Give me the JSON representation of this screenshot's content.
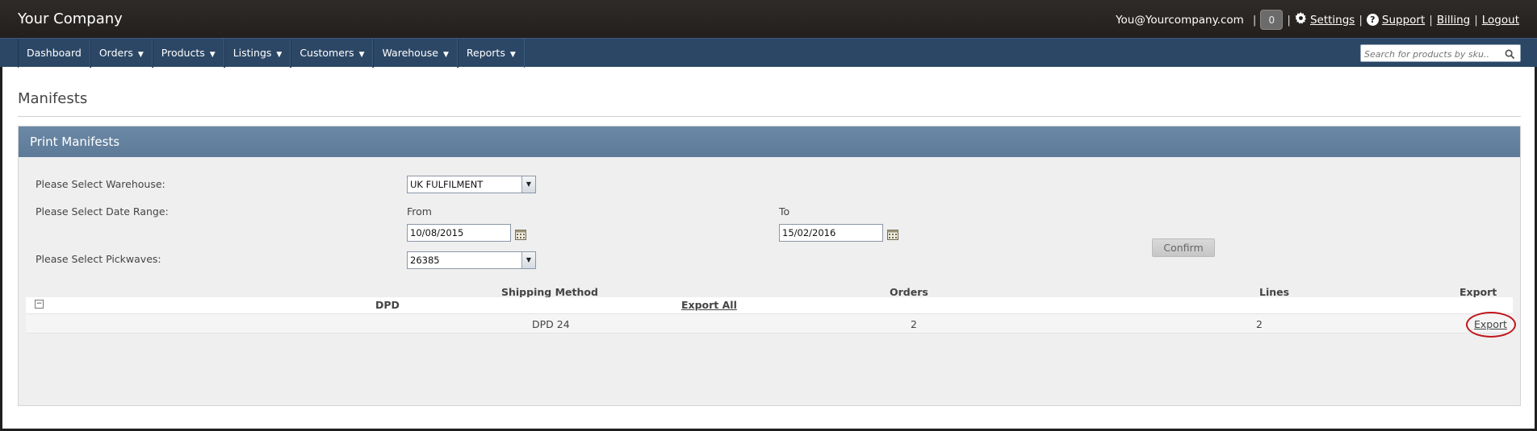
{
  "app": {
    "brand": "Your Company",
    "user_email": "You@Yourcompany.com",
    "notification_count": "0",
    "links": {
      "settings": "Settings",
      "support": "Support",
      "billing": "Billing",
      "logout": "Logout"
    },
    "separator": "|"
  },
  "nav": {
    "items": [
      {
        "label": "Dashboard",
        "dropdown": false
      },
      {
        "label": "Orders",
        "dropdown": true
      },
      {
        "label": "Products",
        "dropdown": true
      },
      {
        "label": "Listings",
        "dropdown": true
      },
      {
        "label": "Customers",
        "dropdown": true
      },
      {
        "label": "Warehouse",
        "dropdown": true
      },
      {
        "label": "Reports",
        "dropdown": true
      }
    ],
    "search_placeholder": "Search for products by sku..",
    "caret": "▼"
  },
  "page": {
    "title": "Manifests"
  },
  "panel": {
    "title": "Print Manifests",
    "warehouse_label": "Please Select Warehouse:",
    "warehouse_value": "UK FULFILMENT",
    "date_range_label": "Please Select Date Range:",
    "from_label": "From",
    "from_value": "10/08/2015",
    "to_label": "To",
    "to_value": "15/02/2016",
    "pickwaves_label": "Please Select Pickwaves:",
    "pickwaves_value": "26385",
    "confirm_label": "Confirm"
  },
  "table": {
    "columns": [
      "Shipping Method",
      "Orders",
      "Lines",
      "Export"
    ],
    "group": {
      "name": "DPD",
      "export_all": "Export All",
      "toggle": "−"
    },
    "rows": [
      {
        "shipping_method": "DPD 24",
        "orders": "2",
        "lines": "2",
        "export": "Export"
      }
    ]
  },
  "colors": {
    "topbar": "#231f1d",
    "navbar": "#2c4766",
    "panel_header": "#5d7b99",
    "highlight_circle": "#c0161b"
  }
}
